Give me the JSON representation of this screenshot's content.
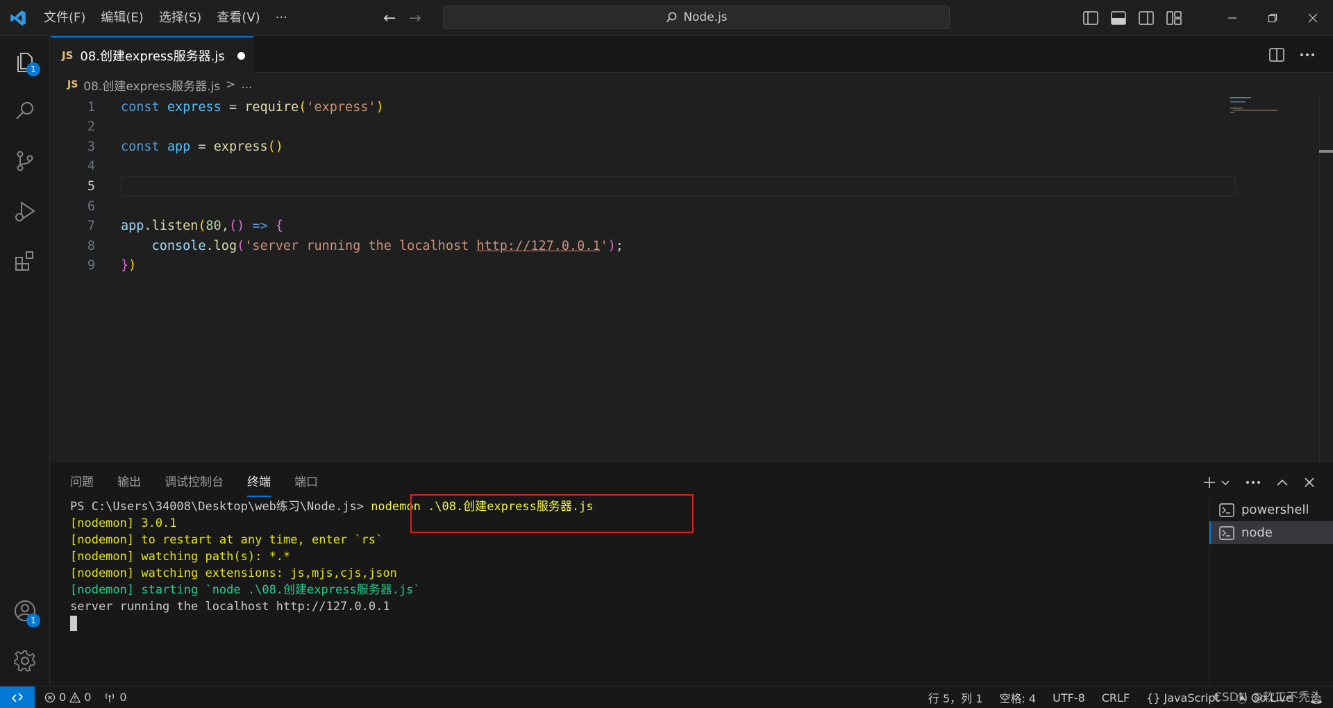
{
  "titlebar": {
    "menu": [
      "文件(F)",
      "编辑(E)",
      "选择(S)",
      "查看(V)",
      "···"
    ],
    "search_text": "Node.js"
  },
  "activity": {
    "explorer_badge": "1",
    "accounts_badge": "1"
  },
  "tab": {
    "icon": "JS",
    "label": "08.创建express服务器.js"
  },
  "breadcrumb": {
    "icon": "JS",
    "file": "08.创建express服务器.js",
    "sep": ">",
    "more": "..."
  },
  "editor": {
    "line_numbers": [
      "1",
      "2",
      "3",
      "4",
      "5",
      "6",
      "7",
      "8",
      "9"
    ]
  },
  "panel": {
    "tabs": [
      "问题",
      "输出",
      "调试控制台",
      "终端",
      "端口"
    ],
    "active_tab": "终端",
    "terminal": {
      "prompt": "PS C:\\Users\\34008\\Desktop\\web练习\\Node.js>",
      "command": "nodemon .\\08.创建express服务器.js",
      "lines": [
        "[nodemon] 3.0.1",
        "[nodemon] to restart at any time, enter `rs`",
        "[nodemon] watching path(s): *.*",
        "[nodemon] watching extensions: js,mjs,cjs,json",
        "[nodemon] starting `node .\\08.创建express服务器.js`",
        "server running the localhost http://127.0.0.1"
      ]
    },
    "terminals": [
      "powershell",
      "node"
    ]
  },
  "statusbar": {
    "errors": "0",
    "warnings": "0",
    "ports": "0",
    "position": "行 5，列 1",
    "spaces": "空格: 4",
    "encoding": "UTF-8",
    "eol": "CRLF",
    "language": "JavaScript",
    "golive": "Go Live"
  },
  "watermark": "CSDN @软工不秃头",
  "colors": {
    "accent": "#0078d4",
    "highlight_box": "#e02020"
  }
}
